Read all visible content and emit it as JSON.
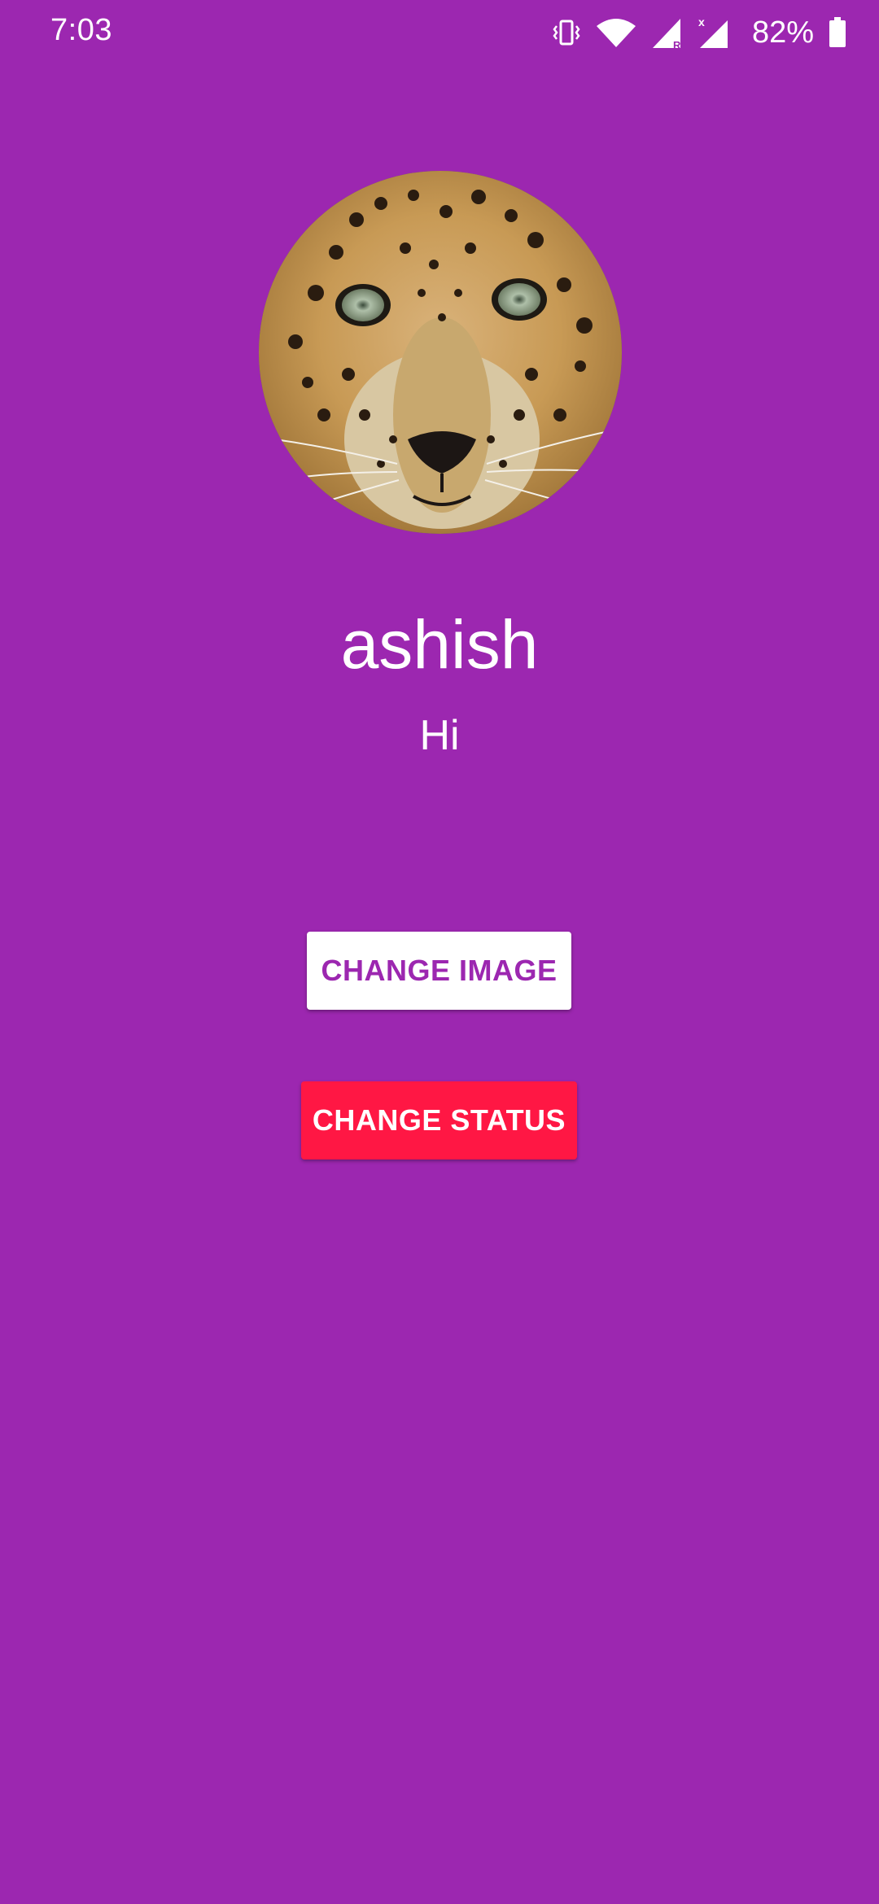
{
  "status_bar": {
    "time": "7:03",
    "battery_percent": "82%",
    "icons": [
      "vibrate-icon",
      "wifi-icon",
      "signal-roaming-icon",
      "signal-icon",
      "battery-icon"
    ]
  },
  "profile": {
    "name": "ashish",
    "status": "Hi",
    "avatar_description": "leopard-face-photo"
  },
  "buttons": {
    "change_image": "CHANGE IMAGE",
    "change_status": "CHANGE STATUS"
  },
  "colors": {
    "background": "#9c27b0",
    "change_image_bg": "#ffffff",
    "change_image_text": "#9c27b0",
    "change_status_bg": "#ff1744",
    "change_status_text": "#ffffff"
  }
}
